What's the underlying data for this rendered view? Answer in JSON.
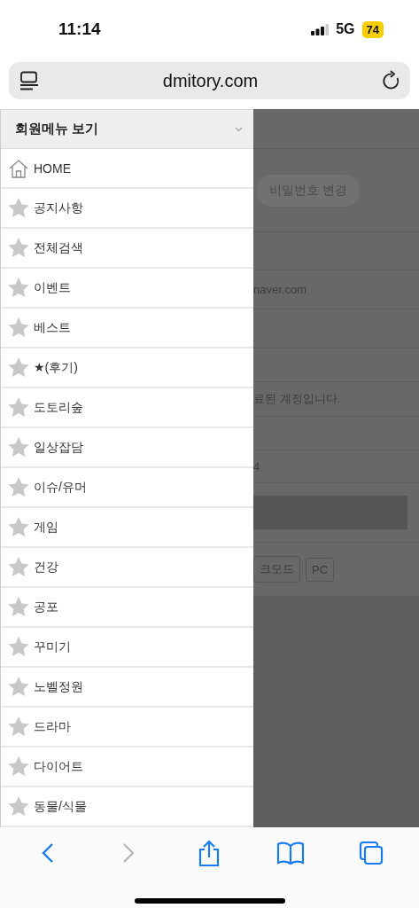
{
  "status_bar": {
    "time": "11:14",
    "network": "5G",
    "battery": "74"
  },
  "address_bar": {
    "url": "dmitory.com"
  },
  "drawer": {
    "title": "회원메뉴 보기",
    "items": [
      {
        "kind": "home",
        "label": "HOME"
      },
      {
        "kind": "star",
        "label": "공지사항"
      },
      {
        "kind": "star",
        "label": "전체검색"
      },
      {
        "kind": "star",
        "label": "이벤트"
      },
      {
        "kind": "star",
        "label": "베스트"
      },
      {
        "kind": "star",
        "label": "★(후기)"
      },
      {
        "kind": "star",
        "label": "도토리숲"
      },
      {
        "kind": "star",
        "label": "일상잡담"
      },
      {
        "kind": "star",
        "label": "이슈/유머"
      },
      {
        "kind": "star",
        "label": "게임"
      },
      {
        "kind": "star",
        "label": "건강"
      },
      {
        "kind": "star",
        "label": "공포"
      },
      {
        "kind": "star",
        "label": "꾸미기"
      },
      {
        "kind": "star",
        "label": "노벨정원"
      },
      {
        "kind": "star",
        "label": "드라마"
      },
      {
        "kind": "star",
        "label": "다이어트"
      },
      {
        "kind": "star",
        "label": "동물/식물"
      }
    ]
  },
  "background_page": {
    "password_button": "비밀번호 변경",
    "email": "naver.com",
    "notice": "료된 계정입니다.",
    "field_fragment": "4",
    "buttons": [
      "크모드",
      "PC"
    ]
  },
  "toolbar": [
    {
      "kind": "back",
      "disabled": false
    },
    {
      "kind": "forward",
      "disabled": true
    },
    {
      "kind": "share",
      "disabled": false
    },
    {
      "kind": "bookmarks",
      "disabled": false
    },
    {
      "kind": "tabs",
      "disabled": false
    }
  ]
}
